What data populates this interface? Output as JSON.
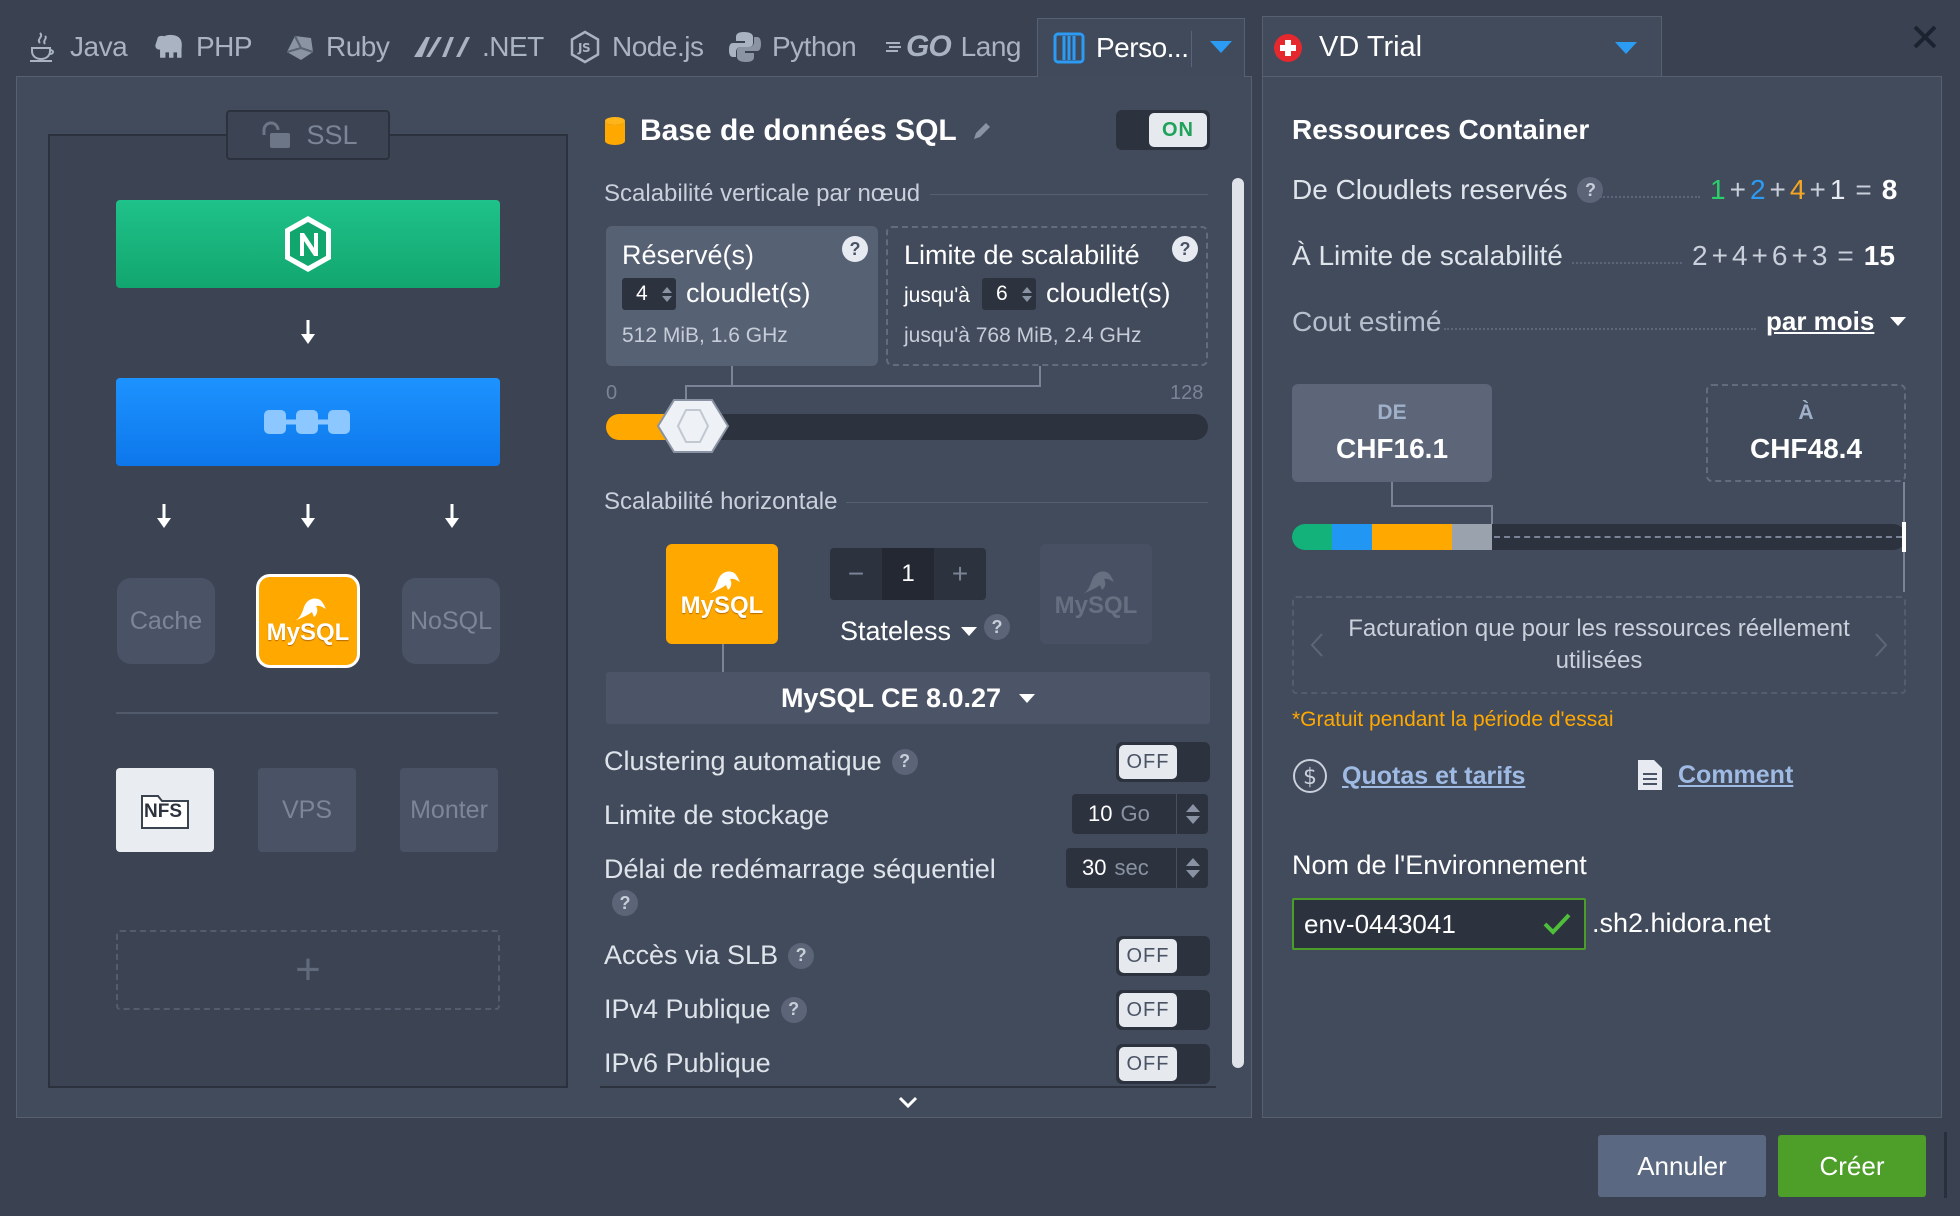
{
  "tabs": [
    {
      "label": "Java",
      "icon": "java-icon"
    },
    {
      "label": "PHP",
      "icon": "php-elephant-icon"
    },
    {
      "label": "Ruby",
      "icon": "ruby-icon"
    },
    {
      "label": ".NET",
      "icon": "dotnet-icon"
    },
    {
      "label": "Node.js",
      "icon": "nodejs-icon"
    },
    {
      "label": "Python",
      "icon": "python-icon"
    },
    {
      "label": "Lang",
      "logo_text": "GO",
      "icon": "go-icon"
    },
    {
      "label": "Perso...",
      "icon": "custom-columns-icon"
    }
  ],
  "region": {
    "label": "VD Trial",
    "icon": "swiss-flag-icon"
  },
  "topology": {
    "ssl_label": "SSL",
    "cache_label": "Cache",
    "mysql_label": "MySQL",
    "nosql_label": "NoSQL",
    "nfs_label": "NFS",
    "vps_label": "VPS",
    "mount_label": "Monter",
    "add_symbol": "+"
  },
  "node": {
    "title": "Base de données SQL",
    "toggle": "ON",
    "vertical_section": "Scalabilité verticale par nœud",
    "reserved": {
      "label": "Réservé(s)",
      "value": "4",
      "unit": "cloudlet(s)",
      "info": "512 MiB, 1.6 GHz"
    },
    "limit": {
      "label": "Limite de scalabilité",
      "prefix": "jusqu'à",
      "value": "6",
      "unit": "cloudlet(s)",
      "info": "jusqu'à 768 MiB, 2.4 GHz"
    },
    "slider": {
      "min_label": "0",
      "max_label": "128",
      "min": 0,
      "max": 128,
      "reserved": 4,
      "limit": 6
    },
    "horizontal_section": "Scalabilité horizontale",
    "stepper": {
      "minus": "−",
      "value": "1",
      "plus": "+"
    },
    "mode": "Stateless",
    "engine_mysql_label": "MySQL",
    "version": "MySQL CE 8.0.27",
    "options": [
      {
        "label": "Clustering automatique",
        "toggle": "OFF"
      },
      {
        "label": "Limite de stockage",
        "value": "10",
        "unit": "Go"
      },
      {
        "label": "Délai de redémarrage séquentiel",
        "value": "30",
        "unit": "sec"
      },
      {
        "label": "Accès via SLB",
        "toggle": "OFF"
      },
      {
        "label": "IPv4 Publique",
        "toggle": "OFF"
      },
      {
        "label": "IPv6 Publique",
        "toggle": "OFF"
      }
    ]
  },
  "resources": {
    "title": "Ressources Container",
    "cloudlets_label": "De Cloudlets reservés",
    "cloudlets_terms": [
      "1",
      "2",
      "4",
      "1"
    ],
    "cloudlets_total": "8",
    "limit_label": "À Limite de scalabilité",
    "limit_terms": [
      "2",
      "4",
      "6",
      "3"
    ],
    "limit_total": "15",
    "cost_label": "Cout estimé",
    "period": "par mois",
    "from_label": "DE",
    "from_value": "CHF16.1",
    "to_label": "À",
    "to_value": "CHF48.4",
    "billing_note": "Facturation que pour les ressources réellement utilisées",
    "trial_note": "*Gratuit pendant la période d'essai",
    "quotas_link": "Quotas et tarifs",
    "howto_link": "Comment",
    "env_label": "Nom de l'Environnement",
    "env_name": "env-0443041",
    "domain_suffix": ".sh2.hidora.net",
    "bar_segments": [
      {
        "color": "#13b27a",
        "share": 0.2
      },
      {
        "color": "#2196f3",
        "share": 0.2
      },
      {
        "color": "#ffa800",
        "share": 0.4
      },
      {
        "color": "#9aa2ae",
        "share": 0.2
      }
    ],
    "term_colors": [
      "#2ad16a",
      "#2b9bf4",
      "#f5a623",
      "#e7ebf1"
    ]
  },
  "footer": {
    "cancel": "Annuler",
    "create": "Créer"
  },
  "colors": {
    "accent_orange": "#ffa800",
    "create_green": "#4e9e2a",
    "nginx_green": "#17b57c",
    "app_blue": "#1485f8"
  }
}
